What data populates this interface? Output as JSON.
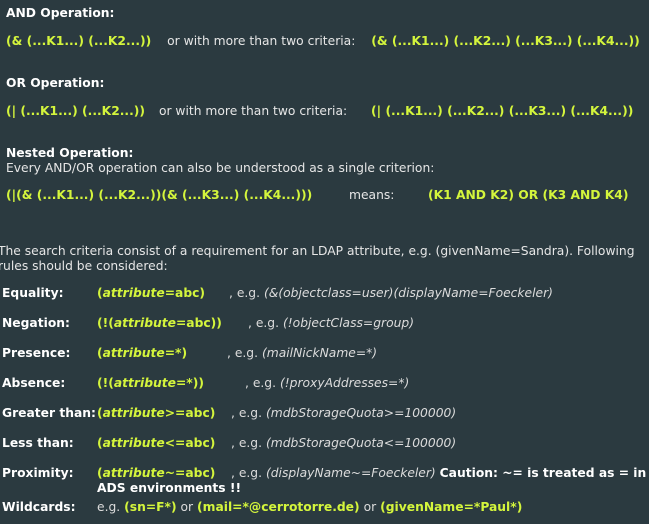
{
  "and": {
    "title": "AND Operation:",
    "expr": "(& (...K1...) (...K2...))",
    "mid": "or with more than two criteria:",
    "expr4": "(& (...K1...) (...K2...) (...K3...) (...K4...))"
  },
  "or": {
    "title": "OR Operation:",
    "expr": "(| (...K1...) (...K2...))",
    "mid": "or with more than two criteria:",
    "expr4": "(| (...K1...) (...K2...) (...K3...) (...K4...))"
  },
  "nested": {
    "title": "Nested Operation:",
    "desc": "Every AND/OR operation can also be understood as a single criterion:",
    "expr": "(|(& (...K1...) (...K2...))(& (...K3...) (...K4...)))",
    "means": "means:",
    "result": "(K1 AND K2) OR (K3 AND K4)"
  },
  "intro": {
    "line1": "The search criteria consist of a requirement for an LDAP attribute, e.g. (givenName=Sandra). Following",
    "line2": "rules should be considered:"
  },
  "rules": [
    {
      "label": "Equality:",
      "pre": "(",
      "attr": "attribute",
      "post": "=abc)",
      "eg": ", e.g.",
      "example": "(&(objectclass=user)(displayName=Foeckeler)"
    },
    {
      "label": "Negation:",
      "pre": "(!(",
      "attr": "attribute",
      "post": "=abc))",
      "eg": ", e.g.",
      "example": "(!objectClass=group)"
    },
    {
      "label": "Presence:",
      "pre": "(",
      "attr": "attribute",
      "post": "=*)",
      "eg": ", e.g.",
      "example": "(mailNickName=*)"
    },
    {
      "label": "Absence:",
      "pre": "(!(",
      "attr": "attribute",
      "post": "=*))",
      "eg": ", e.g.",
      "example": "(!proxyAddresses=*)"
    },
    {
      "label": "Greater than:",
      "pre": "(",
      "attr": "attribute",
      "post": ">=abc)",
      "eg": ", e.g.",
      "example": "(mdbStorageQuota>=100000)"
    },
    {
      "label": "Less than:",
      "pre": "(",
      "attr": "attribute",
      "post": "<=abc)",
      "eg": ", e.g.",
      "example": "(mdbStorageQuota<=100000)"
    },
    {
      "label": "Proximity:",
      "pre": "(",
      "attr": "attribute",
      "post": "~=abc)",
      "eg": ", e.g.",
      "example": "(displayName~=Foeckeler)",
      "caution": "Caution: ~= is treated as = in",
      "caution2": "ADS environments !!"
    }
  ],
  "wildcards": {
    "label": "Wildcards:",
    "eg": "e.g.",
    "ex1": "(sn=F*)",
    "or1": "or",
    "ex2": "(mail=*@cerrotorre.de)",
    "or2": "or",
    "ex3": "(givenName=*Paul*)"
  }
}
